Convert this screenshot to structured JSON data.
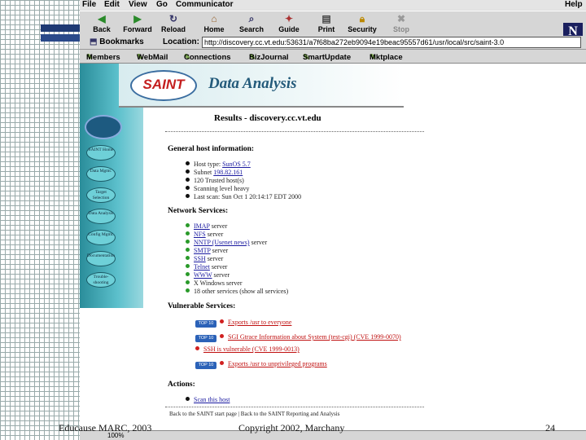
{
  "menu": {
    "items": [
      "File",
      "Edit",
      "View",
      "Go",
      "Communicator"
    ],
    "help": "Help"
  },
  "toolbar": {
    "buttons": [
      {
        "label": "Back",
        "icon": "back-arrow-icon"
      },
      {
        "label": "Forward",
        "icon": "forward-arrow-icon"
      },
      {
        "label": "Reload",
        "icon": "reload-icon"
      },
      {
        "label": "Home",
        "icon": "home-icon"
      },
      {
        "label": "Search",
        "icon": "search-icon"
      },
      {
        "label": "Guide",
        "icon": "guide-icon"
      },
      {
        "label": "Print",
        "icon": "print-icon"
      },
      {
        "label": "Security",
        "icon": "lock-icon"
      },
      {
        "label": "Stop",
        "icon": "stop-icon"
      }
    ]
  },
  "location": {
    "bookmarks": "Bookmarks",
    "label": "Location:",
    "url": "http://discovery.cc.vt.edu:53631/a7f68ba272eb9094e19beac95557d61/usr/local/src/saint-3.0"
  },
  "links": [
    "Members",
    "WebMail",
    "Connections",
    "BizJournal",
    "SmartUpdate",
    "Mktplace"
  ],
  "brand": "N",
  "page": {
    "logo": "SAINT",
    "banner_title": "Data Analysis",
    "results_title": "Results - discovery.cc.vt.edu",
    "nav": [
      "SAINT Home",
      "Data Mgmt.",
      "Target Selection",
      "Data Analysis",
      "Config Mgmt.",
      "Documentation",
      "Trouble-shooting"
    ],
    "general": {
      "heading": "General host information:",
      "items": [
        {
          "text": "Host type: ",
          "link": "SunOS 5.7"
        },
        {
          "text": "Subnet ",
          "link": "198.82.161"
        },
        {
          "text": "120 Trusted host(s)",
          "link": ""
        },
        {
          "text": "Scanning level heavy",
          "link": ""
        },
        {
          "text": "Last scan: Sun Oct 1 20:14:17 EDT 2000",
          "link": ""
        }
      ]
    },
    "network": {
      "heading": "Network Services:",
      "items": [
        {
          "link": "IMAP",
          "text": " server"
        },
        {
          "link": "NFS",
          "text": " server"
        },
        {
          "link": "NNTP (Usenet news)",
          "text": " server"
        },
        {
          "link": "SMTP",
          "text": " server"
        },
        {
          "link": "SSH",
          "text": " server"
        },
        {
          "link": "Telnet",
          "text": " server"
        },
        {
          "link": "WWW",
          "text": " server"
        },
        {
          "link": "",
          "text": "X Windows server"
        },
        {
          "link": "",
          "text": "18 other services (show all services)"
        }
      ]
    },
    "vulnerable": {
      "heading": "Vulnerable Services:",
      "items": [
        {
          "badge": "TOP 10",
          "text": "Exports /usr to everyone"
        },
        {
          "badge": "TOP 10",
          "text": "SGI Gtrace Information about System (test-cgi) (CVE 1999-0070)"
        },
        {
          "badge": "",
          "text": "SSH is vulnerable (CVE 1999-0013)"
        },
        {
          "badge": "TOP 10",
          "text": "Exports /usr to unprivileged programs"
        }
      ]
    },
    "actions": {
      "heading": "Actions:",
      "item": "Scan this host",
      "back": "Back to the SAINT start page | Back to the SAINT Reporting and Analysis"
    }
  },
  "status": {
    "zoom": "100%"
  },
  "footer": {
    "left": "Educause MARC, 2003",
    "center": "Copyright 2002, Marchany",
    "page": "24"
  }
}
